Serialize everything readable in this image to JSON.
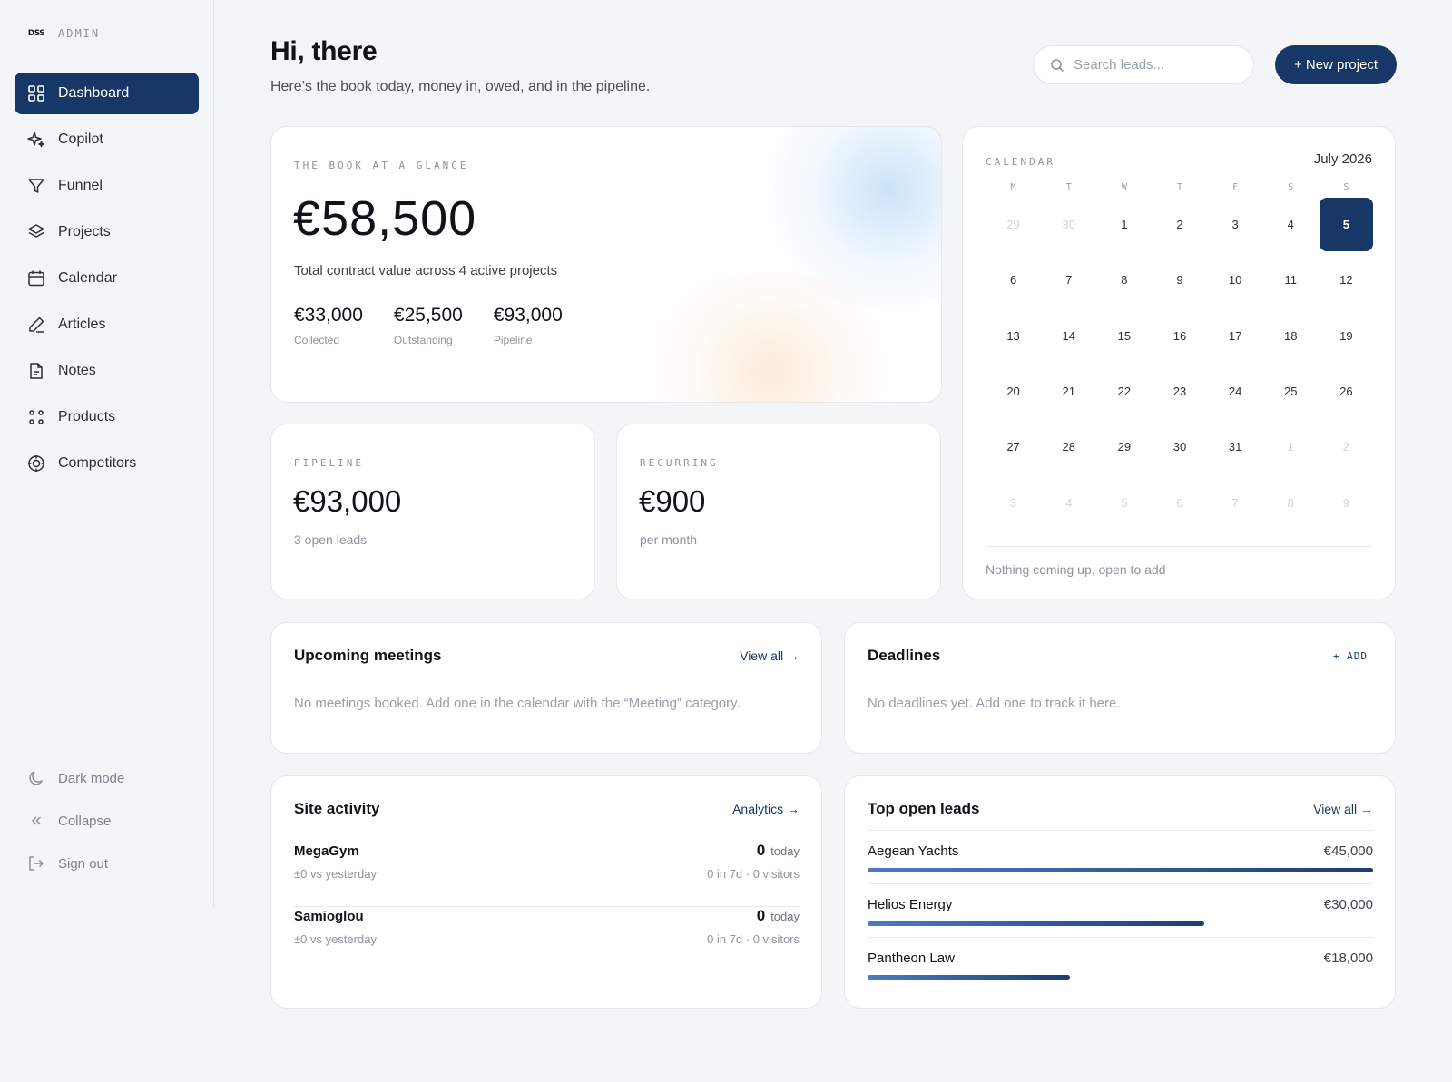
{
  "brand": {
    "logo": "DSS",
    "label": "ADMIN"
  },
  "nav": {
    "items": [
      {
        "label": "Dashboard",
        "icon": "grid-icon",
        "active": true
      },
      {
        "label": "Copilot",
        "icon": "sparkle-icon"
      },
      {
        "label": "Funnel",
        "icon": "funnel-icon"
      },
      {
        "label": "Projects",
        "icon": "layers-icon"
      },
      {
        "label": "Calendar",
        "icon": "calendar-icon"
      },
      {
        "label": "Articles",
        "icon": "pen-icon"
      },
      {
        "label": "Notes",
        "icon": "document-icon"
      },
      {
        "label": "Products",
        "icon": "dots-icon"
      },
      {
        "label": "Competitors",
        "icon": "target-icon"
      }
    ],
    "bottom": {
      "dark_mode": "Dark mode",
      "collapse": "Collapse",
      "sign_out": "Sign out"
    }
  },
  "header": {
    "greeting": "Hi, there",
    "subtitle": "Here’s the book today, money in, owed, and in the pipeline.",
    "search_placeholder": "Search leads...",
    "new_project": "+ New project"
  },
  "book": {
    "label": "THE BOOK AT A GLANCE",
    "total": "€58,500",
    "description": "Total contract value across 4 active projects",
    "stats": [
      {
        "value": "€33,000",
        "label": "Collected"
      },
      {
        "value": "€25,500",
        "label": "Outstanding"
      },
      {
        "value": "€93,000",
        "label": "Pipeline"
      }
    ]
  },
  "pipeline": {
    "label": "PIPELINE",
    "value": "€93,000",
    "sub": "3 open leads"
  },
  "recurring": {
    "label": "RECURRING",
    "value": "€900",
    "sub": "per month"
  },
  "calendar": {
    "label": "CALENDAR",
    "month": "July 2026",
    "weekdays": [
      "M",
      "T",
      "W",
      "T",
      "F",
      "S",
      "S"
    ],
    "days": [
      {
        "d": "29",
        "m": true
      },
      {
        "d": "30",
        "m": true
      },
      {
        "d": "1"
      },
      {
        "d": "2"
      },
      {
        "d": "3"
      },
      {
        "d": "4"
      },
      {
        "d": "5",
        "today": true
      },
      {
        "d": "6"
      },
      {
        "d": "7"
      },
      {
        "d": "8"
      },
      {
        "d": "9"
      },
      {
        "d": "10"
      },
      {
        "d": "11"
      },
      {
        "d": "12"
      },
      {
        "d": "13"
      },
      {
        "d": "14"
      },
      {
        "d": "15"
      },
      {
        "d": "16"
      },
      {
        "d": "17"
      },
      {
        "d": "18"
      },
      {
        "d": "19"
      },
      {
        "d": "20"
      },
      {
        "d": "21"
      },
      {
        "d": "22"
      },
      {
        "d": "23"
      },
      {
        "d": "24"
      },
      {
        "d": "25"
      },
      {
        "d": "26"
      },
      {
        "d": "27"
      },
      {
        "d": "28"
      },
      {
        "d": "29"
      },
      {
        "d": "30"
      },
      {
        "d": "31"
      },
      {
        "d": "1",
        "m": true
      },
      {
        "d": "2",
        "m": true
      },
      {
        "d": "3",
        "m": true
      },
      {
        "d": "4",
        "m": true
      },
      {
        "d": "5",
        "m": true
      },
      {
        "d": "6",
        "m": true
      },
      {
        "d": "7",
        "m": true
      },
      {
        "d": "8",
        "m": true
      },
      {
        "d": "9",
        "m": true
      }
    ],
    "empty": "Nothing coming up, open to add"
  },
  "meetings": {
    "title": "Upcoming meetings",
    "link": "View all →",
    "empty": "No meetings booked. Add one in the calendar with the “Meeting” category."
  },
  "deadlines": {
    "title": "Deadlines",
    "link": "+ ADD",
    "empty": "No deadlines yet. Add one to track it here."
  },
  "activity": {
    "title": "Site activity",
    "link": "Analytics →",
    "rows": [
      {
        "name": "MegaGym",
        "delta": "±0 vs yesterday",
        "count": "0",
        "count_label": "today",
        "meta": "0 in 7d · 0 visitors"
      },
      {
        "name": "Samioglou",
        "delta": "±0 vs yesterday",
        "count": "0",
        "count_label": "today",
        "meta": "0 in 7d · 0 visitors"
      }
    ]
  },
  "leads": {
    "title": "Top open leads",
    "link": "View all →",
    "rows": [
      {
        "name": "Aegean Yachts",
        "value": "€45,000",
        "amount": 45000
      },
      {
        "name": "Helios Energy",
        "value": "€30,000",
        "amount": 30000
      },
      {
        "name": "Pantheon Law",
        "value": "€18,000",
        "amount": 18000
      }
    ]
  },
  "colors": {
    "accent": "#173766",
    "background": "#f4f5f7"
  }
}
